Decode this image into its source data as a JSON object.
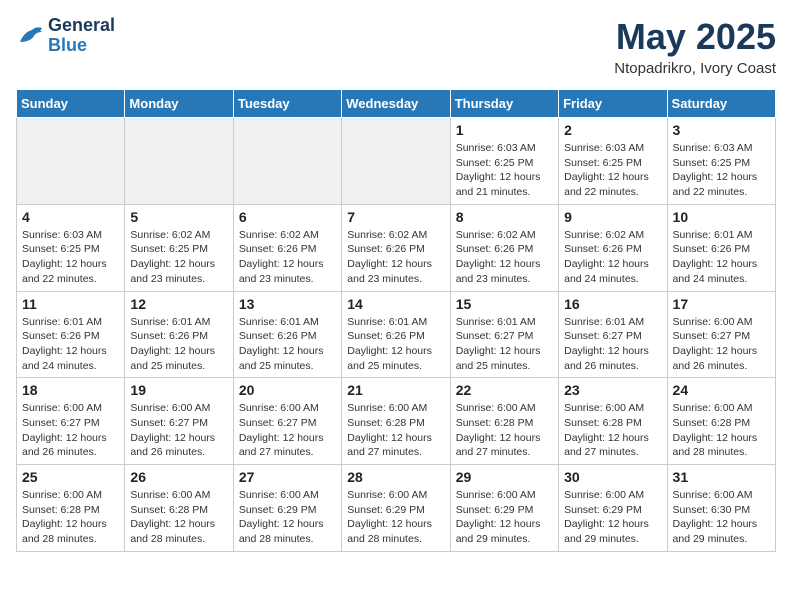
{
  "header": {
    "logo_line1": "General",
    "logo_line2": "Blue",
    "month": "May 2025",
    "location": "Ntopadrikro, Ivory Coast"
  },
  "weekdays": [
    "Sunday",
    "Monday",
    "Tuesday",
    "Wednesday",
    "Thursday",
    "Friday",
    "Saturday"
  ],
  "weeks": [
    [
      {
        "day": "",
        "info": ""
      },
      {
        "day": "",
        "info": ""
      },
      {
        "day": "",
        "info": ""
      },
      {
        "day": "",
        "info": ""
      },
      {
        "day": "1",
        "info": "Sunrise: 6:03 AM\nSunset: 6:25 PM\nDaylight: 12 hours\nand 21 minutes."
      },
      {
        "day": "2",
        "info": "Sunrise: 6:03 AM\nSunset: 6:25 PM\nDaylight: 12 hours\nand 22 minutes."
      },
      {
        "day": "3",
        "info": "Sunrise: 6:03 AM\nSunset: 6:25 PM\nDaylight: 12 hours\nand 22 minutes."
      }
    ],
    [
      {
        "day": "4",
        "info": "Sunrise: 6:03 AM\nSunset: 6:25 PM\nDaylight: 12 hours\nand 22 minutes."
      },
      {
        "day": "5",
        "info": "Sunrise: 6:02 AM\nSunset: 6:25 PM\nDaylight: 12 hours\nand 23 minutes."
      },
      {
        "day": "6",
        "info": "Sunrise: 6:02 AM\nSunset: 6:26 PM\nDaylight: 12 hours\nand 23 minutes."
      },
      {
        "day": "7",
        "info": "Sunrise: 6:02 AM\nSunset: 6:26 PM\nDaylight: 12 hours\nand 23 minutes."
      },
      {
        "day": "8",
        "info": "Sunrise: 6:02 AM\nSunset: 6:26 PM\nDaylight: 12 hours\nand 23 minutes."
      },
      {
        "day": "9",
        "info": "Sunrise: 6:02 AM\nSunset: 6:26 PM\nDaylight: 12 hours\nand 24 minutes."
      },
      {
        "day": "10",
        "info": "Sunrise: 6:01 AM\nSunset: 6:26 PM\nDaylight: 12 hours\nand 24 minutes."
      }
    ],
    [
      {
        "day": "11",
        "info": "Sunrise: 6:01 AM\nSunset: 6:26 PM\nDaylight: 12 hours\nand 24 minutes."
      },
      {
        "day": "12",
        "info": "Sunrise: 6:01 AM\nSunset: 6:26 PM\nDaylight: 12 hours\nand 25 minutes."
      },
      {
        "day": "13",
        "info": "Sunrise: 6:01 AM\nSunset: 6:26 PM\nDaylight: 12 hours\nand 25 minutes."
      },
      {
        "day": "14",
        "info": "Sunrise: 6:01 AM\nSunset: 6:26 PM\nDaylight: 12 hours\nand 25 minutes."
      },
      {
        "day": "15",
        "info": "Sunrise: 6:01 AM\nSunset: 6:27 PM\nDaylight: 12 hours\nand 25 minutes."
      },
      {
        "day": "16",
        "info": "Sunrise: 6:01 AM\nSunset: 6:27 PM\nDaylight: 12 hours\nand 26 minutes."
      },
      {
        "day": "17",
        "info": "Sunrise: 6:00 AM\nSunset: 6:27 PM\nDaylight: 12 hours\nand 26 minutes."
      }
    ],
    [
      {
        "day": "18",
        "info": "Sunrise: 6:00 AM\nSunset: 6:27 PM\nDaylight: 12 hours\nand 26 minutes."
      },
      {
        "day": "19",
        "info": "Sunrise: 6:00 AM\nSunset: 6:27 PM\nDaylight: 12 hours\nand 26 minutes."
      },
      {
        "day": "20",
        "info": "Sunrise: 6:00 AM\nSunset: 6:27 PM\nDaylight: 12 hours\nand 27 minutes."
      },
      {
        "day": "21",
        "info": "Sunrise: 6:00 AM\nSunset: 6:28 PM\nDaylight: 12 hours\nand 27 minutes."
      },
      {
        "day": "22",
        "info": "Sunrise: 6:00 AM\nSunset: 6:28 PM\nDaylight: 12 hours\nand 27 minutes."
      },
      {
        "day": "23",
        "info": "Sunrise: 6:00 AM\nSunset: 6:28 PM\nDaylight: 12 hours\nand 27 minutes."
      },
      {
        "day": "24",
        "info": "Sunrise: 6:00 AM\nSunset: 6:28 PM\nDaylight: 12 hours\nand 28 minutes."
      }
    ],
    [
      {
        "day": "25",
        "info": "Sunrise: 6:00 AM\nSunset: 6:28 PM\nDaylight: 12 hours\nand 28 minutes."
      },
      {
        "day": "26",
        "info": "Sunrise: 6:00 AM\nSunset: 6:28 PM\nDaylight: 12 hours\nand 28 minutes."
      },
      {
        "day": "27",
        "info": "Sunrise: 6:00 AM\nSunset: 6:29 PM\nDaylight: 12 hours\nand 28 minutes."
      },
      {
        "day": "28",
        "info": "Sunrise: 6:00 AM\nSunset: 6:29 PM\nDaylight: 12 hours\nand 28 minutes."
      },
      {
        "day": "29",
        "info": "Sunrise: 6:00 AM\nSunset: 6:29 PM\nDaylight: 12 hours\nand 29 minutes."
      },
      {
        "day": "30",
        "info": "Sunrise: 6:00 AM\nSunset: 6:29 PM\nDaylight: 12 hours\nand 29 minutes."
      },
      {
        "day": "31",
        "info": "Sunrise: 6:00 AM\nSunset: 6:30 PM\nDaylight: 12 hours\nand 29 minutes."
      }
    ]
  ]
}
